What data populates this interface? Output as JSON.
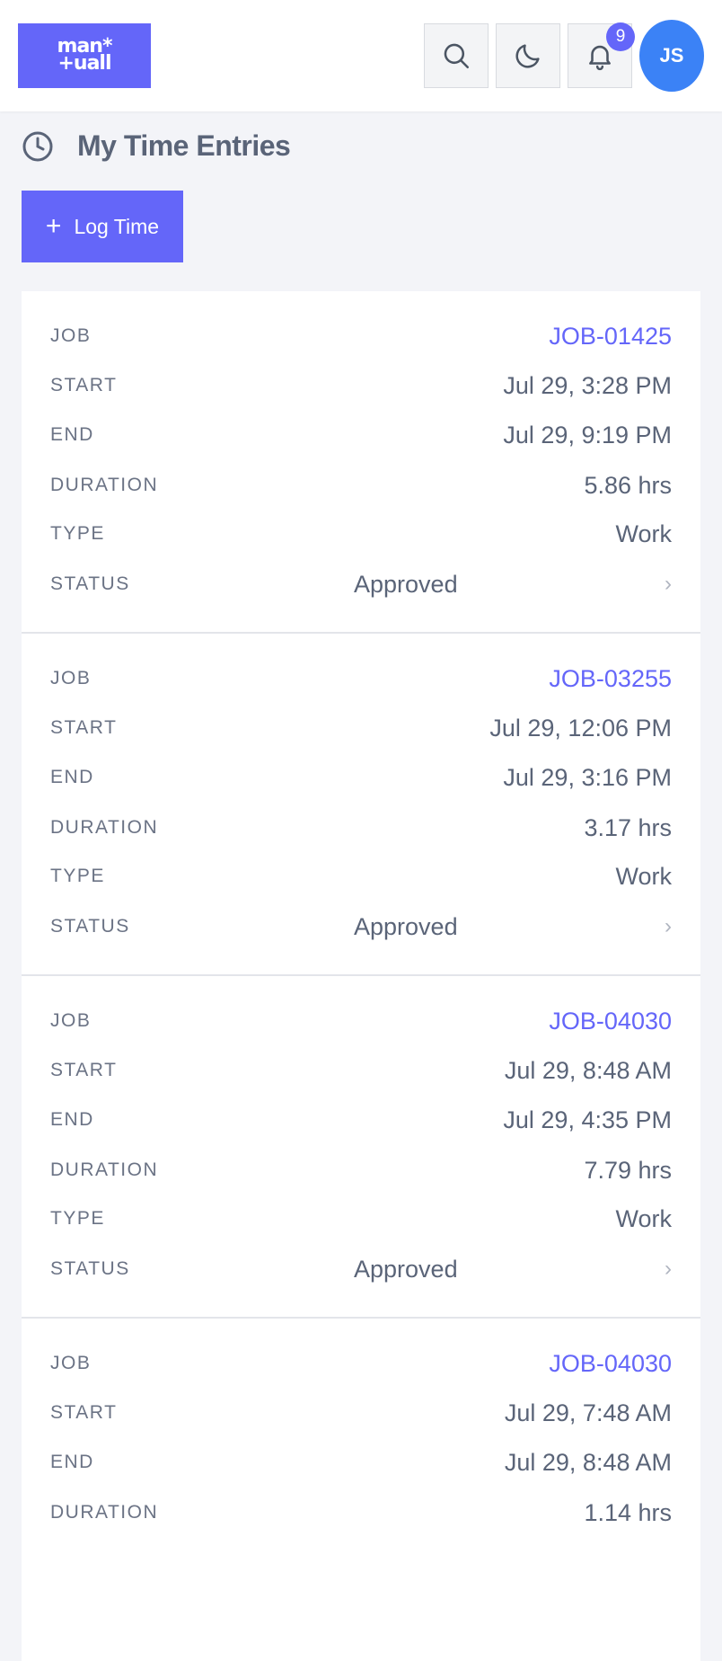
{
  "header": {
    "logo_line1": "man*",
    "logo_line2": "+uall",
    "notification_count": "9",
    "avatar_initials": "JS"
  },
  "page": {
    "title": "My Time Entries",
    "log_button_icon": "+",
    "log_button_label": "Log Time"
  },
  "labels": {
    "job": "JOB",
    "start": "START",
    "end": "END",
    "duration": "DURATION",
    "type": "TYPE",
    "status": "STATUS"
  },
  "entries": [
    {
      "job": "JOB-01425",
      "start": "Jul 29, 3:28 PM",
      "end": "Jul 29, 9:19 PM",
      "duration": "5.86 hrs",
      "type": "Work",
      "status": "Approved"
    },
    {
      "job": "JOB-03255",
      "start": "Jul 29, 12:06 PM",
      "end": "Jul 29, 3:16 PM",
      "duration": "3.17 hrs",
      "type": "Work",
      "status": "Approved"
    },
    {
      "job": "JOB-04030",
      "start": "Jul 29, 8:48 AM",
      "end": "Jul 29, 4:35 PM",
      "duration": "7.79 hrs",
      "type": "Work",
      "status": "Approved"
    },
    {
      "job": "JOB-04030",
      "start": "Jul 29, 7:48 AM",
      "end": "Jul 29, 8:48 AM",
      "duration": "1.14 hrs",
      "type": "",
      "status": ""
    }
  ],
  "icons": {
    "search": "search-icon",
    "theme": "moon-icon",
    "notifications": "bell-icon",
    "page": "clock-icon",
    "row_arrow": "chevron-right-icon"
  },
  "colors": {
    "accent": "#6466f9",
    "avatar": "#3b82f6",
    "background": "#f3f4f8"
  }
}
